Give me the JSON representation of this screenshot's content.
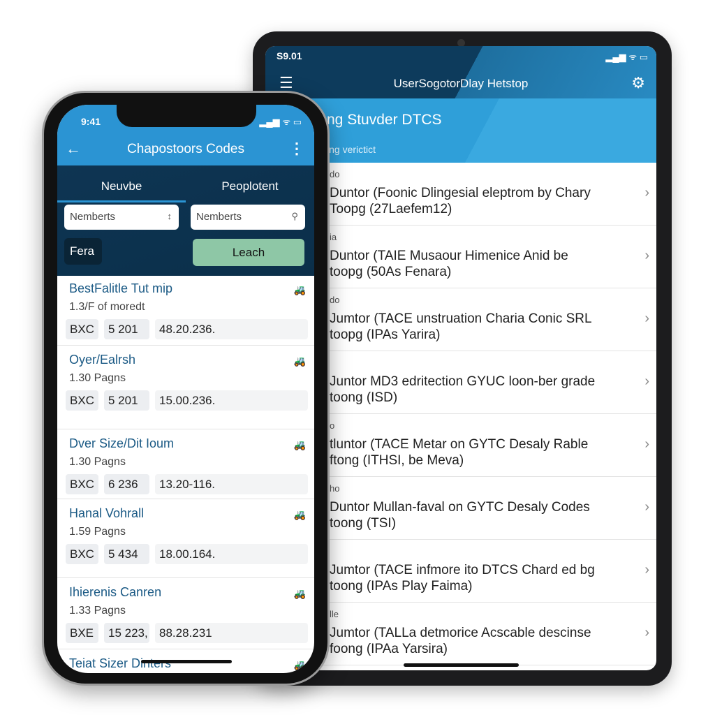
{
  "tablet": {
    "status_time": "S9.01",
    "signal": "▂▄▆ ᯤ ▭",
    "title": "UserSogotorDlay Hetstop",
    "banner_title": "ng Stuvder DTCS",
    "banner_subtitle": "ing verictict",
    "rows": [
      {
        "label": "do",
        "line1": "Duntor (Foonic Dlingesial eleptrom by Chary",
        "line2": "Toopg (27Laefem12)"
      },
      {
        "label": "ia",
        "line1": "Duntor (TAIE Musaour Himenice Anid be",
        "line2": "toopg (50As Fenara)"
      },
      {
        "label": "do",
        "line1": "Jumtor (TACE unstruation Charia Conic SRL",
        "line2": "toopg (IPAs Yarira)"
      },
      {
        "label": "",
        "line1": "Juntor MD3 edritection GYUC loon-ber grade",
        "line2": "toong (ISD)"
      },
      {
        "label": "o",
        "line1": "tluntor (TACE Metar on GYTC Desaly Rable",
        "line2": "ftong (ITHSI, be Meva)"
      },
      {
        "label": "ho",
        "line1": "Duntor Mullan-faval on GYTC Desaly Codes",
        "line2": "toong (TSI)"
      },
      {
        "label": "",
        "line1": "Jumtor (TACE infmore ito DTCS Chard ed bg",
        "line2": "toong (IPAs Play Faima)"
      },
      {
        "label": "lle",
        "line1": "Jumtor (TALLa detmorice Acscable descinse",
        "line2": "foong (IPAa Yarsira)"
      }
    ]
  },
  "phone": {
    "status_time": "9:41",
    "signal": "▂▄▆ ᯤ ▭",
    "title": "Chapostoors Codes",
    "tabs": [
      "Neuvbe",
      "Peoplotent"
    ],
    "input1": "Nemberts",
    "input2": "Nemberts",
    "fera": "Fera",
    "leach": "Leach",
    "items": [
      {
        "title": "BestFalitle Tut mip",
        "sub": "1.3/F of moredt",
        "code": "BXC",
        "num": "5 201",
        "val": "48.20.236."
      },
      {
        "title": "Oyer/Ealrsh",
        "sub": "1.30 Pagns",
        "code": "BXC",
        "num": "5 201",
        "val": "15.00.236."
      },
      {
        "title": "Dver Size/Dit Ioum",
        "sub": "1.30 Pagns",
        "code": "BXC",
        "num": "6 236",
        "val": "13.20-116."
      },
      {
        "title": "Hanal Vohrall",
        "sub": "1.59 Pagns",
        "code": "BXC",
        "num": "5 434",
        "val": "18.00.164."
      },
      {
        "title": "Ihierenis Canren",
        "sub": "1.33 Pagns",
        "code": "BXE",
        "num": "15 223,",
        "val": "88.28.231"
      },
      {
        "title": "Teiat Sizer Dinters",
        "sub": "",
        "code": "",
        "num": "",
        "val": ""
      }
    ]
  },
  "colors": {
    "accent": "#2b94d3",
    "dark": "#0d3b5c",
    "button_green": "#8ec7a6",
    "item_title": "#1b5a85"
  }
}
